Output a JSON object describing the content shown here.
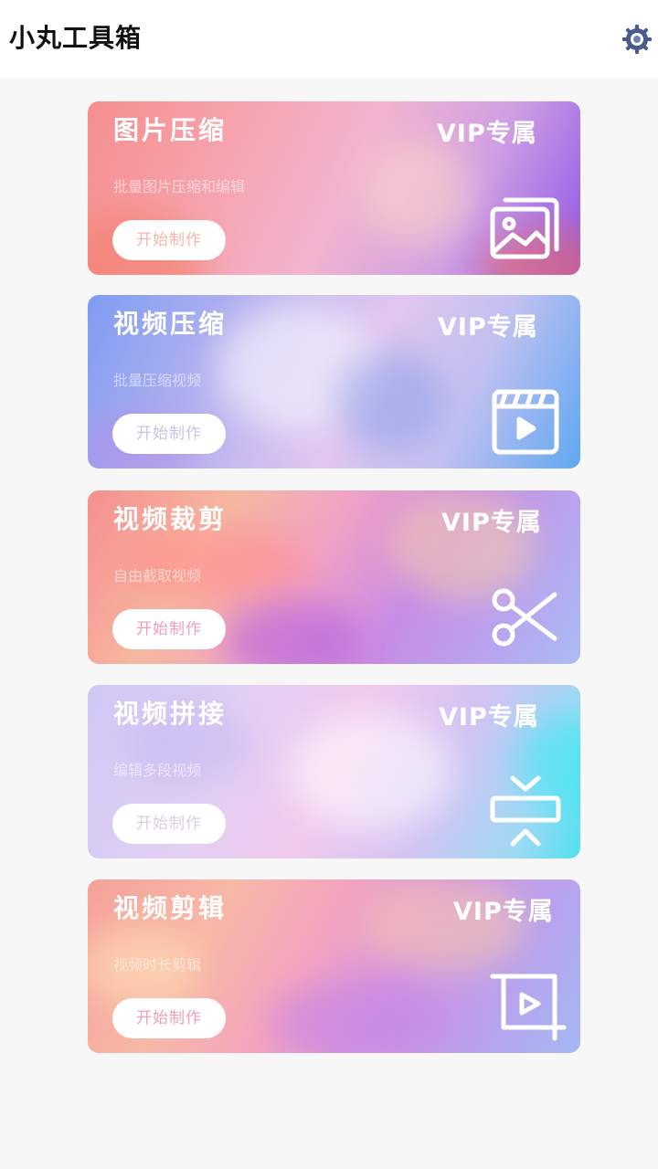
{
  "header": {
    "title": "小丸工具箱",
    "settings_icon": "gear-icon"
  },
  "cards": [
    {
      "title": "图片压缩",
      "vip": "VIP专属",
      "desc": "批量图片压缩和编辑",
      "button": "开始制作",
      "icon": "image-stack-icon",
      "button_color": "#f6b6a8"
    },
    {
      "title": "视频压缩",
      "vip": "VIP专属",
      "desc": "批量压缩视频",
      "button": "开始制作",
      "icon": "clapperboard-icon",
      "button_color": "#c9c2e6"
    },
    {
      "title": "视频裁剪",
      "vip": "VIP专属",
      "desc": "自由截取视频",
      "button": "开始制作",
      "icon": "scissors-icon",
      "button_color": "#f0a0b4"
    },
    {
      "title": "视频拼接",
      "vip": "VIP专属",
      "desc": "编辑多段视频",
      "button": "开始制作",
      "icon": "merge-icon",
      "button_color": "#d9cde8"
    },
    {
      "title": "视频剪辑",
      "vip": "VIP专属",
      "desc": "视频时长剪辑",
      "button": "开始制作",
      "icon": "crop-play-icon",
      "button_color": "#f0a0b4"
    }
  ]
}
